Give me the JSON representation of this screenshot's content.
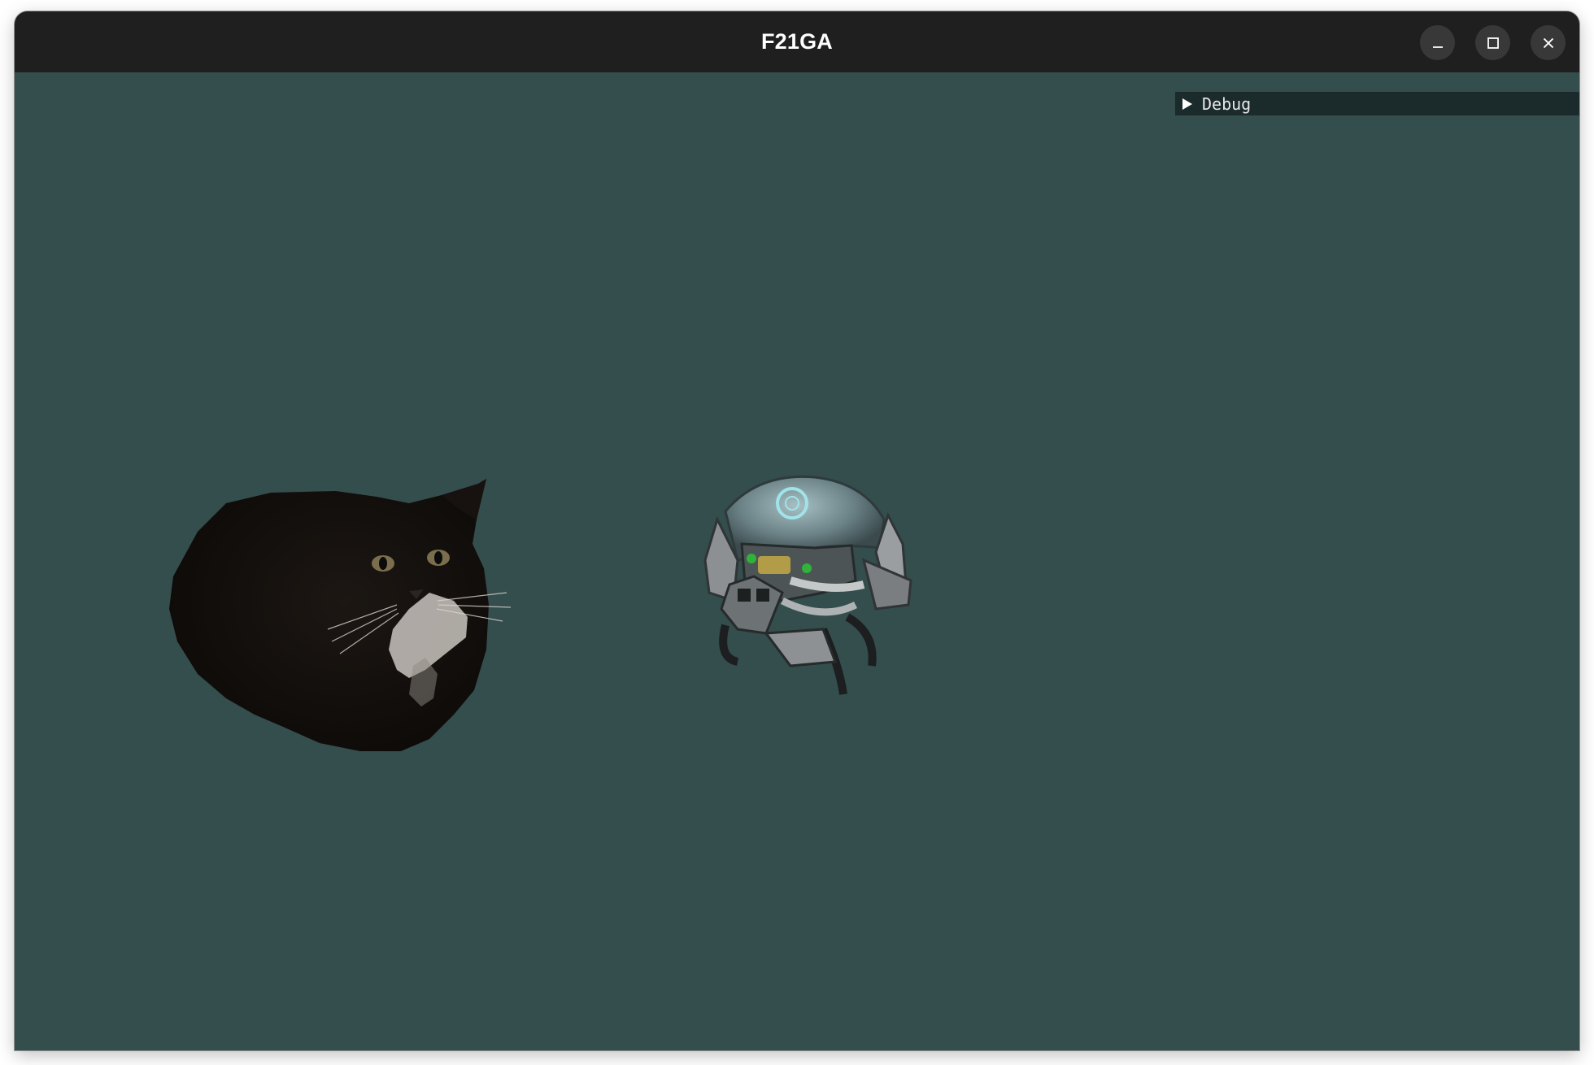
{
  "window": {
    "title": "F21GA",
    "controls": {
      "minimize": "minimize-icon",
      "maximize": "maximize-icon",
      "close": "close-icon"
    }
  },
  "viewport": {
    "background_color": "#344d4d",
    "debug_panel": {
      "label": "Debug",
      "collapsed": true,
      "arrow_icon": "triangle-right-icon"
    },
    "objects": [
      {
        "name": "cat-model"
      },
      {
        "name": "drone-model"
      }
    ]
  },
  "colors": {
    "titlebar": "#1f1f1f",
    "title_text": "#ffffff",
    "debug_panel_bg": "#1b2a2b",
    "debug_text": "#e6e6e6"
  }
}
